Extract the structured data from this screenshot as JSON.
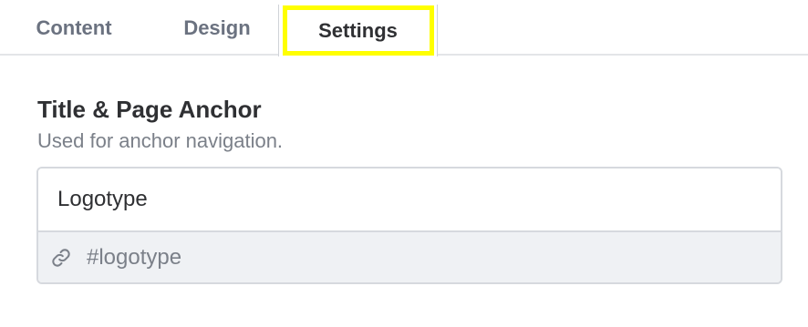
{
  "tabs": [
    {
      "label": "Content",
      "active": false
    },
    {
      "label": "Design",
      "active": false
    },
    {
      "label": "Settings",
      "active": true
    }
  ],
  "section": {
    "title": "Title & Page Anchor",
    "subtitle": "Used for anchor navigation."
  },
  "title_field": {
    "value": "Logotype"
  },
  "anchor": {
    "icon": "link-icon",
    "value": "#logotype"
  },
  "colors": {
    "highlight": "#ffff00",
    "text_primary": "#2f3033",
    "text_muted": "#7b8089",
    "border": "#d6d9de",
    "anchor_bg": "#eff1f4"
  }
}
